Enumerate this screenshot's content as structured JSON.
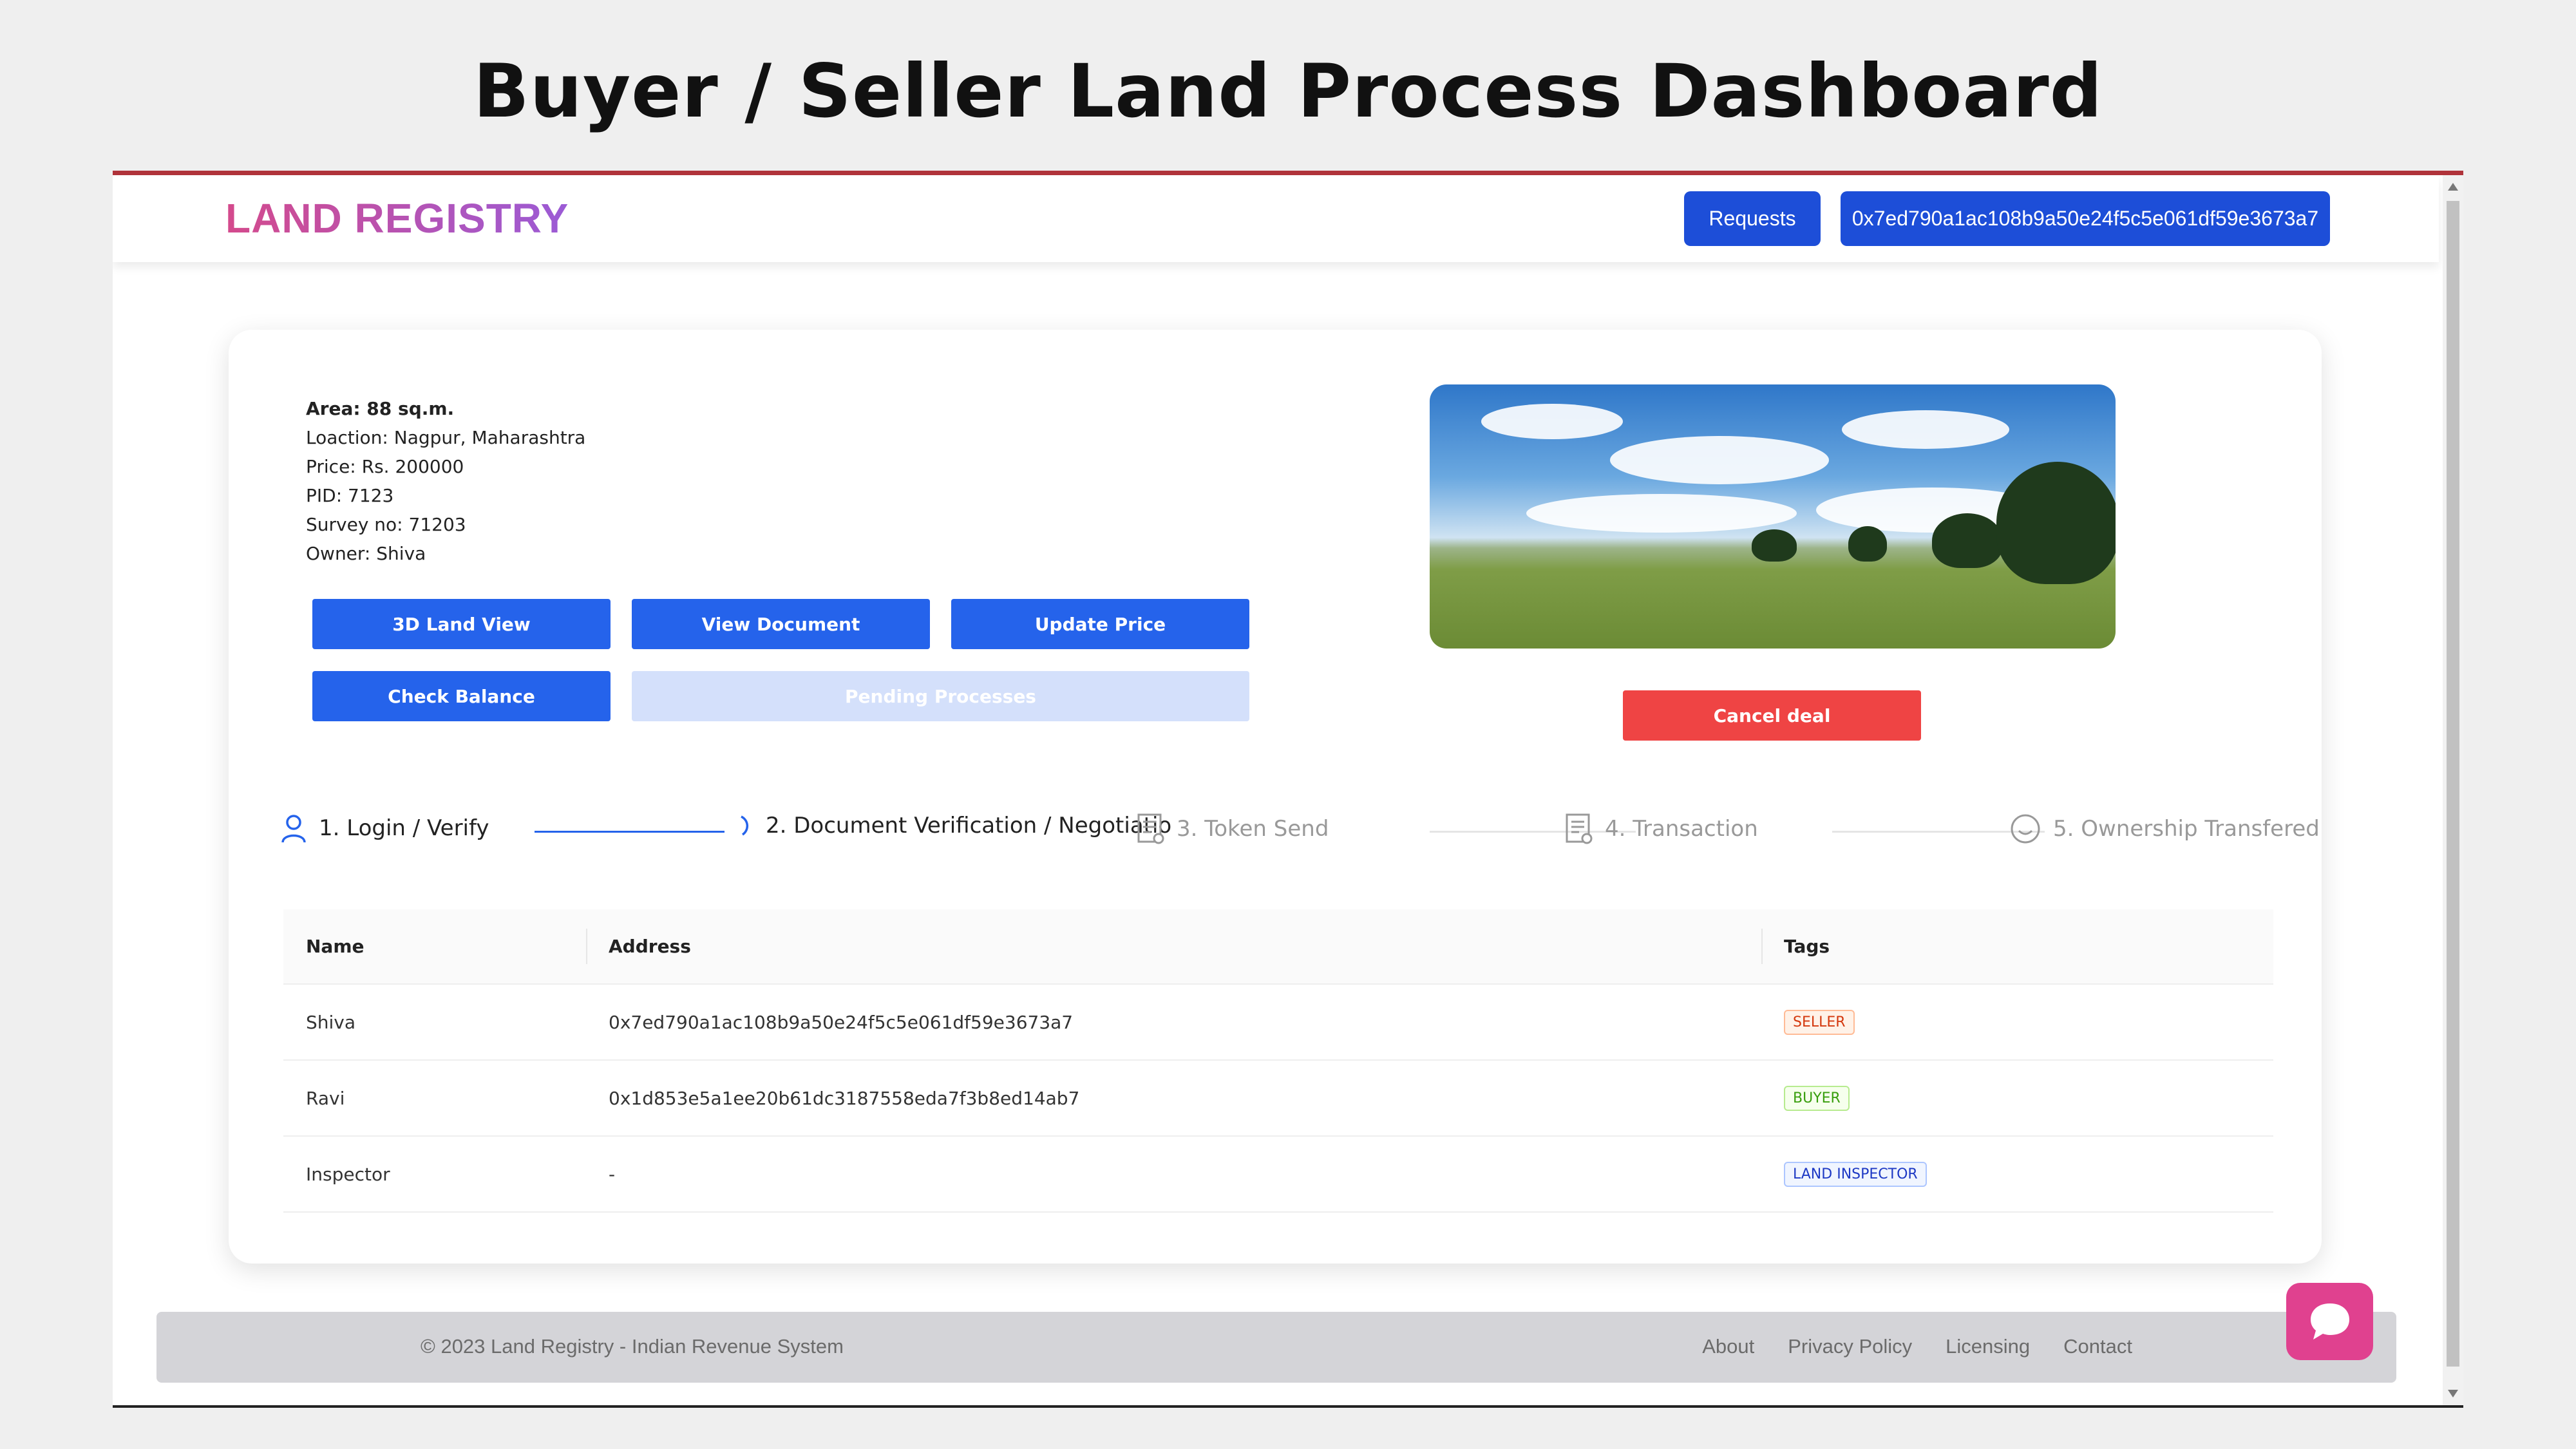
{
  "slide_title": "Buyer / Seller Land Process Dashboard",
  "nav": {
    "brand": "LAND REGISTRY",
    "requests_label": "Requests",
    "account_address": "0x7ed790a1ac108b9a50e24f5c5e061df59e3673a7"
  },
  "land": {
    "area": "Area: 88 sq.m.",
    "location": "Loaction: Nagpur, Maharashtra",
    "price": "Price: Rs. 200000",
    "pid": "PID: 7123",
    "survey": "Survey no: 71203",
    "owner": "Owner: Shiva"
  },
  "buttons": {
    "land_view": "3D Land View",
    "view_document": "View Document",
    "update_price": "Update Price",
    "check_balance": "Check Balance",
    "pending_processes": "Pending Processes",
    "cancel_deal": "Cancel deal"
  },
  "steps": [
    {
      "label": "1. Login / Verify",
      "icon": "user-icon",
      "state": "done"
    },
    {
      "label": "2. Document Verification / Negotiatio",
      "icon": "loading-icon",
      "state": "active"
    },
    {
      "label": "3. Token Send",
      "icon": "document-icon",
      "state": "waiting"
    },
    {
      "label": "4. Transaction",
      "icon": "document-icon",
      "state": "waiting"
    },
    {
      "label": "5. Ownership Transfered",
      "icon": "smile-icon",
      "state": "waiting"
    }
  ],
  "table": {
    "headers": [
      "Name",
      "Address",
      "Tags"
    ],
    "rows": [
      {
        "name": "Shiva",
        "address": "0x7ed790a1ac108b9a50e24f5c5e061df59e3673a7",
        "tag": "SELLER"
      },
      {
        "name": "Ravi",
        "address": "0x1d853e5a1ee20b61dc3187558eda7f3b8ed14ab7",
        "tag": "BUYER"
      },
      {
        "name": "Inspector",
        "address": "-",
        "tag": "LAND INSPECTOR"
      }
    ]
  },
  "footer": {
    "copyright": "© 2023 Land Registry - Indian Revenue System",
    "links": [
      "About",
      "Privacy Policy",
      "Licensing",
      "Contact"
    ]
  },
  "colors": {
    "primary": "#2563eb",
    "nav_button": "#1d4ed8",
    "danger": "#ef4444",
    "chat": "#e0418f"
  }
}
